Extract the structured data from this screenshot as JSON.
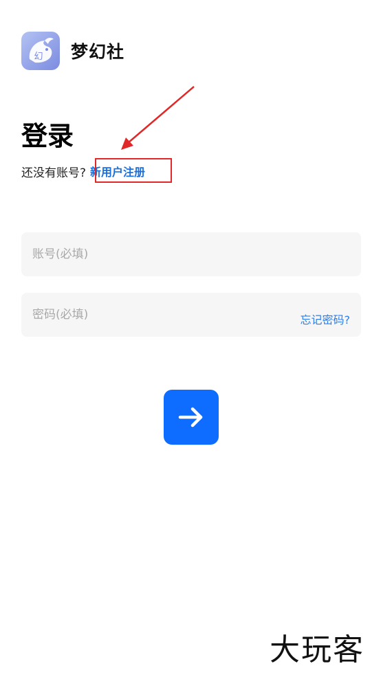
{
  "app": {
    "title": "梦幻社",
    "logo_glyph": "幻",
    "logo_gradient": [
      "#a8b8f0",
      "#7f8ee2"
    ]
  },
  "login": {
    "title": "登录",
    "register_prompt": "还没有账号?",
    "register_link": "新用户注册"
  },
  "form": {
    "account_placeholder": "账号(必填)",
    "password_placeholder": "密码(必填)",
    "forgot_password": "忘记密码?"
  },
  "submit": {
    "icon": "arrow-right-icon",
    "color": "#0e6cff"
  },
  "annotation": {
    "color": "#e02828"
  },
  "watermark": {
    "text": "大玩客"
  }
}
